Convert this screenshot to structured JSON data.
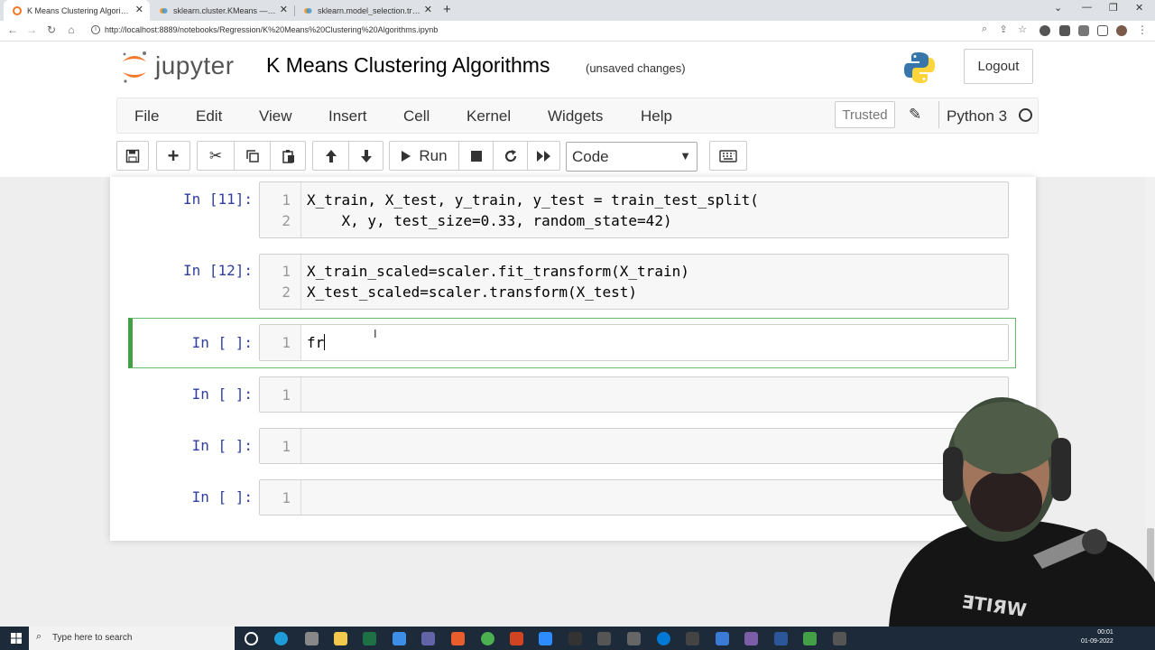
{
  "browser": {
    "tabs": [
      {
        "title": "K Means Clustering Algorithms -",
        "active": true
      },
      {
        "title": "sklearn.cluster.KMeans — scikit-l",
        "active": false
      },
      {
        "title": "sklearn.model_selection.train_te",
        "active": false
      }
    ],
    "url": "http://localhost:8889/notebooks/Regression/K%20Means%20Clustering%20Algorithms.ipynb"
  },
  "header": {
    "brand": "jupyter",
    "notebook_title": "K Means Clustering Algorithms",
    "status": "(unsaved changes)",
    "logout_label": "Logout"
  },
  "menu": {
    "items": [
      "File",
      "Edit",
      "View",
      "Insert",
      "Cell",
      "Kernel",
      "Widgets",
      "Help"
    ],
    "trusted_label": "Trusted",
    "kernel_name": "Python 3"
  },
  "toolbar": {
    "run_label": "Run",
    "cell_type": "Code"
  },
  "cells": [
    {
      "prompt": "In [11]:",
      "lines": [
        {
          "n": "1",
          "text": "X_train, X_test, y_train, y_test = train_test_split("
        },
        {
          "n": "2",
          "text": "    X, y, test_size=0.33, random_state=42)"
        }
      ]
    },
    {
      "prompt": "In [12]:",
      "lines": [
        {
          "n": "1",
          "text": "X_train_scaled=scaler.fit_transform(X_train)"
        },
        {
          "n": "2",
          "text": "X_test_scaled=scaler.transform(X_test)"
        }
      ]
    },
    {
      "prompt": "In [ ]:",
      "lines": [
        {
          "n": "1",
          "text": "fr"
        }
      ]
    },
    {
      "prompt": "In [ ]:",
      "lines": [
        {
          "n": "1",
          "text": ""
        }
      ]
    },
    {
      "prompt": "In [ ]:",
      "lines": [
        {
          "n": "1",
          "text": ""
        }
      ]
    },
    {
      "prompt": "In [ ]:",
      "lines": [
        {
          "n": "1",
          "text": ""
        }
      ]
    }
  ],
  "taskbar": {
    "search_placeholder": "Type here to search",
    "time": "00:01",
    "date": "01-09-2022"
  },
  "colors": {
    "selected_cell": "#42a047",
    "prompt": "#303f9f",
    "jupyter_orange": "#f37726"
  }
}
